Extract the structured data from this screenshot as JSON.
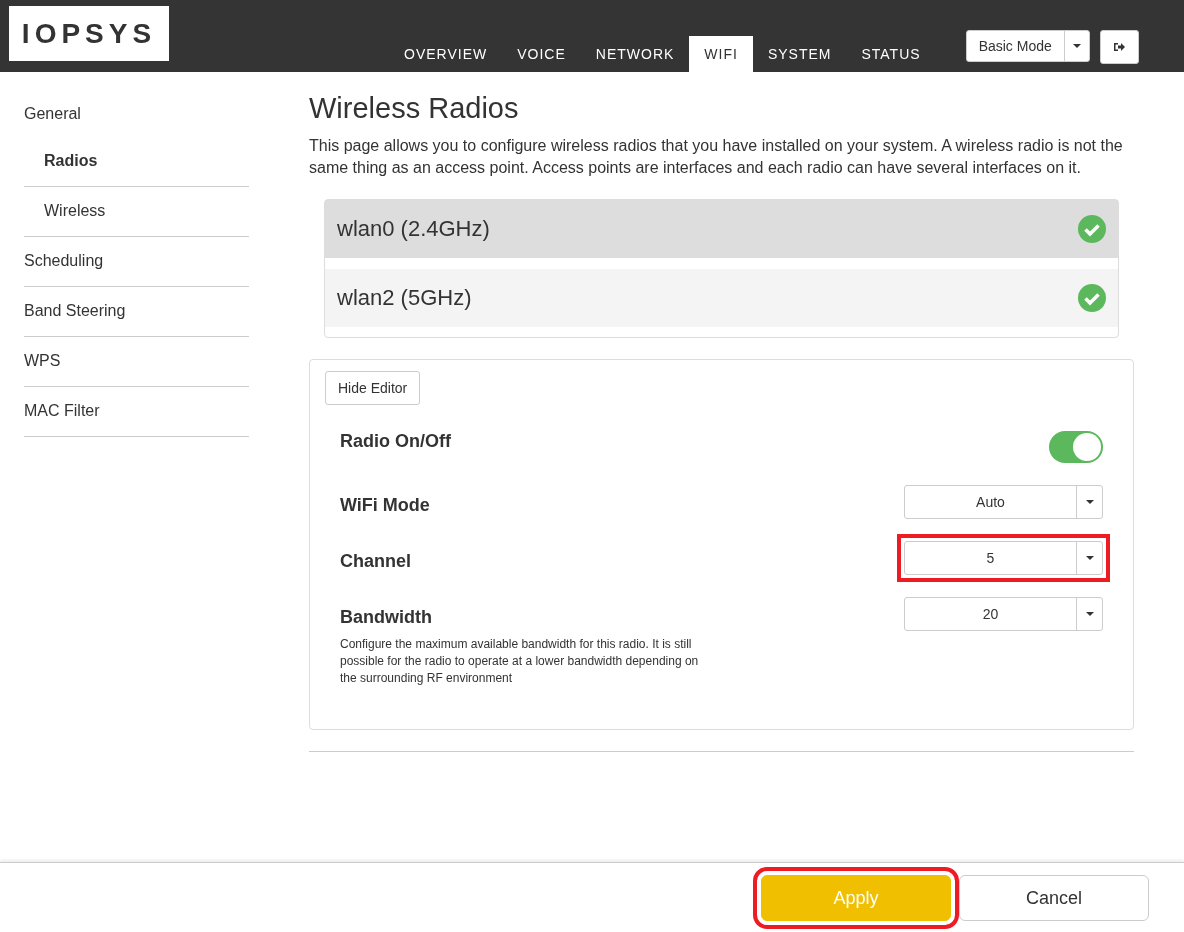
{
  "header": {
    "logo": "IOPSYS",
    "tabs": [
      {
        "label": "OVERVIEW",
        "selected": false
      },
      {
        "label": "VOICE",
        "selected": false
      },
      {
        "label": "NETWORK",
        "selected": false
      },
      {
        "label": "WIFI",
        "selected": true
      },
      {
        "label": "SYSTEM",
        "selected": false
      },
      {
        "label": "STATUS",
        "selected": false
      }
    ],
    "mode_select": {
      "value": "Basic Mode"
    }
  },
  "sidebar": {
    "items": [
      {
        "label": "General",
        "selected": false,
        "children": [
          {
            "label": "Radios",
            "selected": true
          },
          {
            "label": "Wireless",
            "selected": false
          }
        ]
      },
      {
        "label": "Scheduling",
        "selected": false
      },
      {
        "label": "Band Steering",
        "selected": false
      },
      {
        "label": "WPS",
        "selected": false
      },
      {
        "label": "MAC Filter",
        "selected": false
      }
    ]
  },
  "page": {
    "title": "Wireless Radios",
    "description": "This page allows you to configure wireless radios that you have installed on your system. A wireless radio is not the same thing as an access point. Access points are interfaces and each radio can have several interfaces on it.",
    "radios": [
      {
        "name": "wlan0 (2.4GHz)",
        "selected": true,
        "enabled": true
      },
      {
        "name": "wlan2 (5GHz)",
        "selected": false,
        "enabled": true
      }
    ],
    "editor": {
      "toggle_button": "Hide Editor",
      "settings": [
        {
          "kind": "toggle",
          "label": "Radio On/Off",
          "on": true
        },
        {
          "kind": "select",
          "label": "WiFi Mode",
          "value": "Auto",
          "highlighted": false
        },
        {
          "kind": "select",
          "label": "Channel",
          "value": "5",
          "highlighted": true
        },
        {
          "kind": "select",
          "label": "Bandwidth",
          "value": "20",
          "highlighted": false,
          "description": "Configure the maximum available bandwidth for this radio. It is still possible for the radio to operate at a lower bandwidth depending on the surrounding RF environment"
        }
      ]
    }
  },
  "footer": {
    "buttons": [
      {
        "label": "Apply",
        "kind": "primary",
        "highlighted": true
      },
      {
        "label": "Cancel",
        "kind": "secondary",
        "highlighted": false
      }
    ]
  }
}
